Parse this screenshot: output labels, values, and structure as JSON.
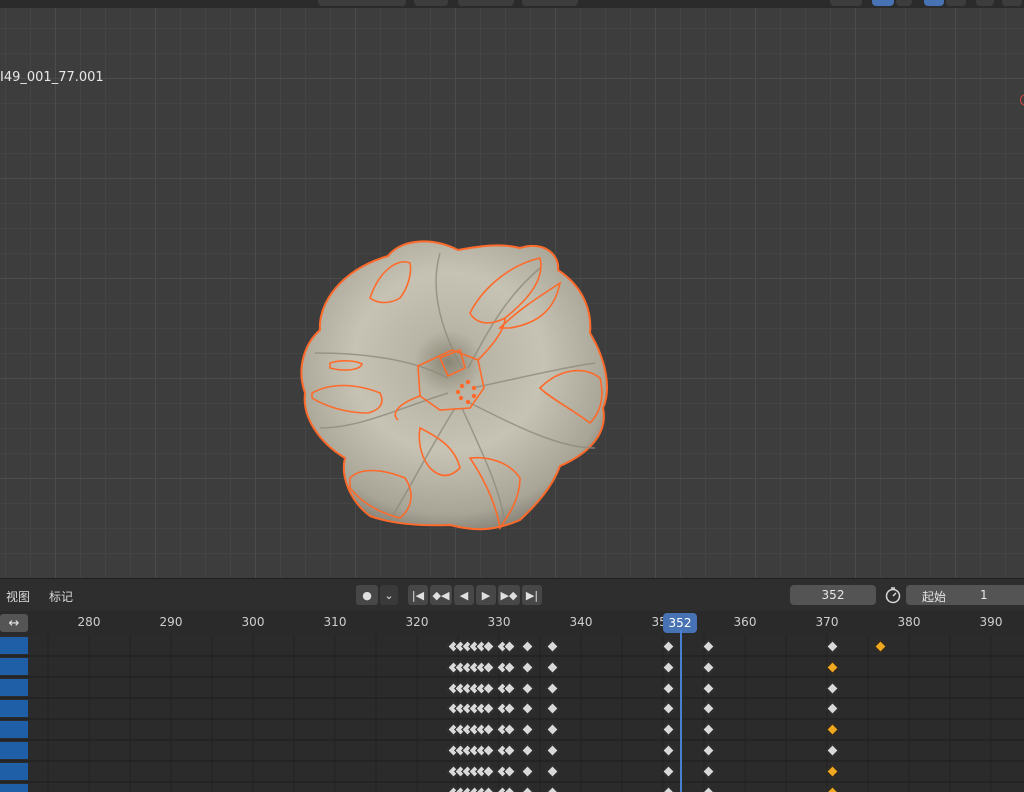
{
  "viewport": {
    "object_name": "I49_001_77.001"
  },
  "timeline": {
    "menu": {
      "view": "视图",
      "markers": "标记"
    },
    "current_frame": "352",
    "start_label": "起始",
    "start_value": "1",
    "ruler_ticks": [
      "280",
      "290",
      "300",
      "310",
      "320",
      "330",
      "340",
      "350",
      "360",
      "370",
      "380",
      "390"
    ],
    "playhead_label": "352",
    "swap_glyph": "↔",
    "buttons": {
      "record": "●",
      "record_menu": "⌄",
      "jump_start": "|◀",
      "prev_keyframe": "◆◀",
      "play_reverse": "◀",
      "play": "▶",
      "next_keyframe": "▶◆",
      "jump_end": "▶|"
    },
    "keyframe_rows": 8
  },
  "colors": {
    "accent": "#4772b3",
    "selection_outline": "#ff6a2a",
    "keyframe_selected": "#f0a820",
    "keyframe": "#d9d9d9"
  }
}
